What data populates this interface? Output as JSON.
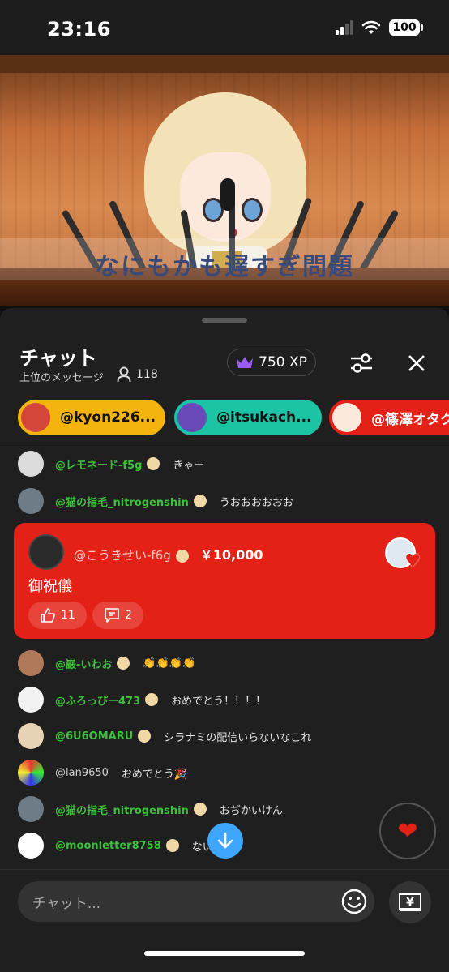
{
  "status_bar": {
    "time": "23:16",
    "battery": "100"
  },
  "video": {
    "caption": "なにもかも遅すぎ問題"
  },
  "chat": {
    "title": "チャット",
    "subtitle": "上位のメッセージ",
    "viewer_count": "118",
    "xp": "750 XP",
    "pinned": [
      {
        "name": "@kyon226...",
        "color": "#f5b40d"
      },
      {
        "name": "@itsukach...",
        "color": "#1cc3a5"
      },
      {
        "name": "@篠澤オタク",
        "color": "#e42116"
      }
    ],
    "messages_top": [
      {
        "author": "@レモネード-f5g",
        "text": "きゃー"
      },
      {
        "author": "@猫の指毛_nitrogenshin",
        "text": "うおおおおおお"
      }
    ],
    "superchat": {
      "author": "@こうきせい-f6g",
      "amount": "￥10,000",
      "message": "御祝儀",
      "likes": "11",
      "replies": "2"
    },
    "messages_bottom": [
      {
        "author": "@巌-いわお",
        "text": "👏👏👏👏",
        "member": true
      },
      {
        "author": "@ふろっぴー473",
        "text": "おめでとう！！！！",
        "member": true
      },
      {
        "author": "@6U6OMARU",
        "text": "シラナミの配信いらないなこれ",
        "member": true
      },
      {
        "author": "@lan9650",
        "text": "おめでとう🎉",
        "member": false
      },
      {
        "author": "@猫の指毛_nitrogenshin",
        "text": "おぢかいけん",
        "member": true
      },
      {
        "author": "@moonletter8758",
        "text": "ない",
        "member": true
      }
    ],
    "input_placeholder": "チャット...",
    "yen_symbol": "¥"
  }
}
